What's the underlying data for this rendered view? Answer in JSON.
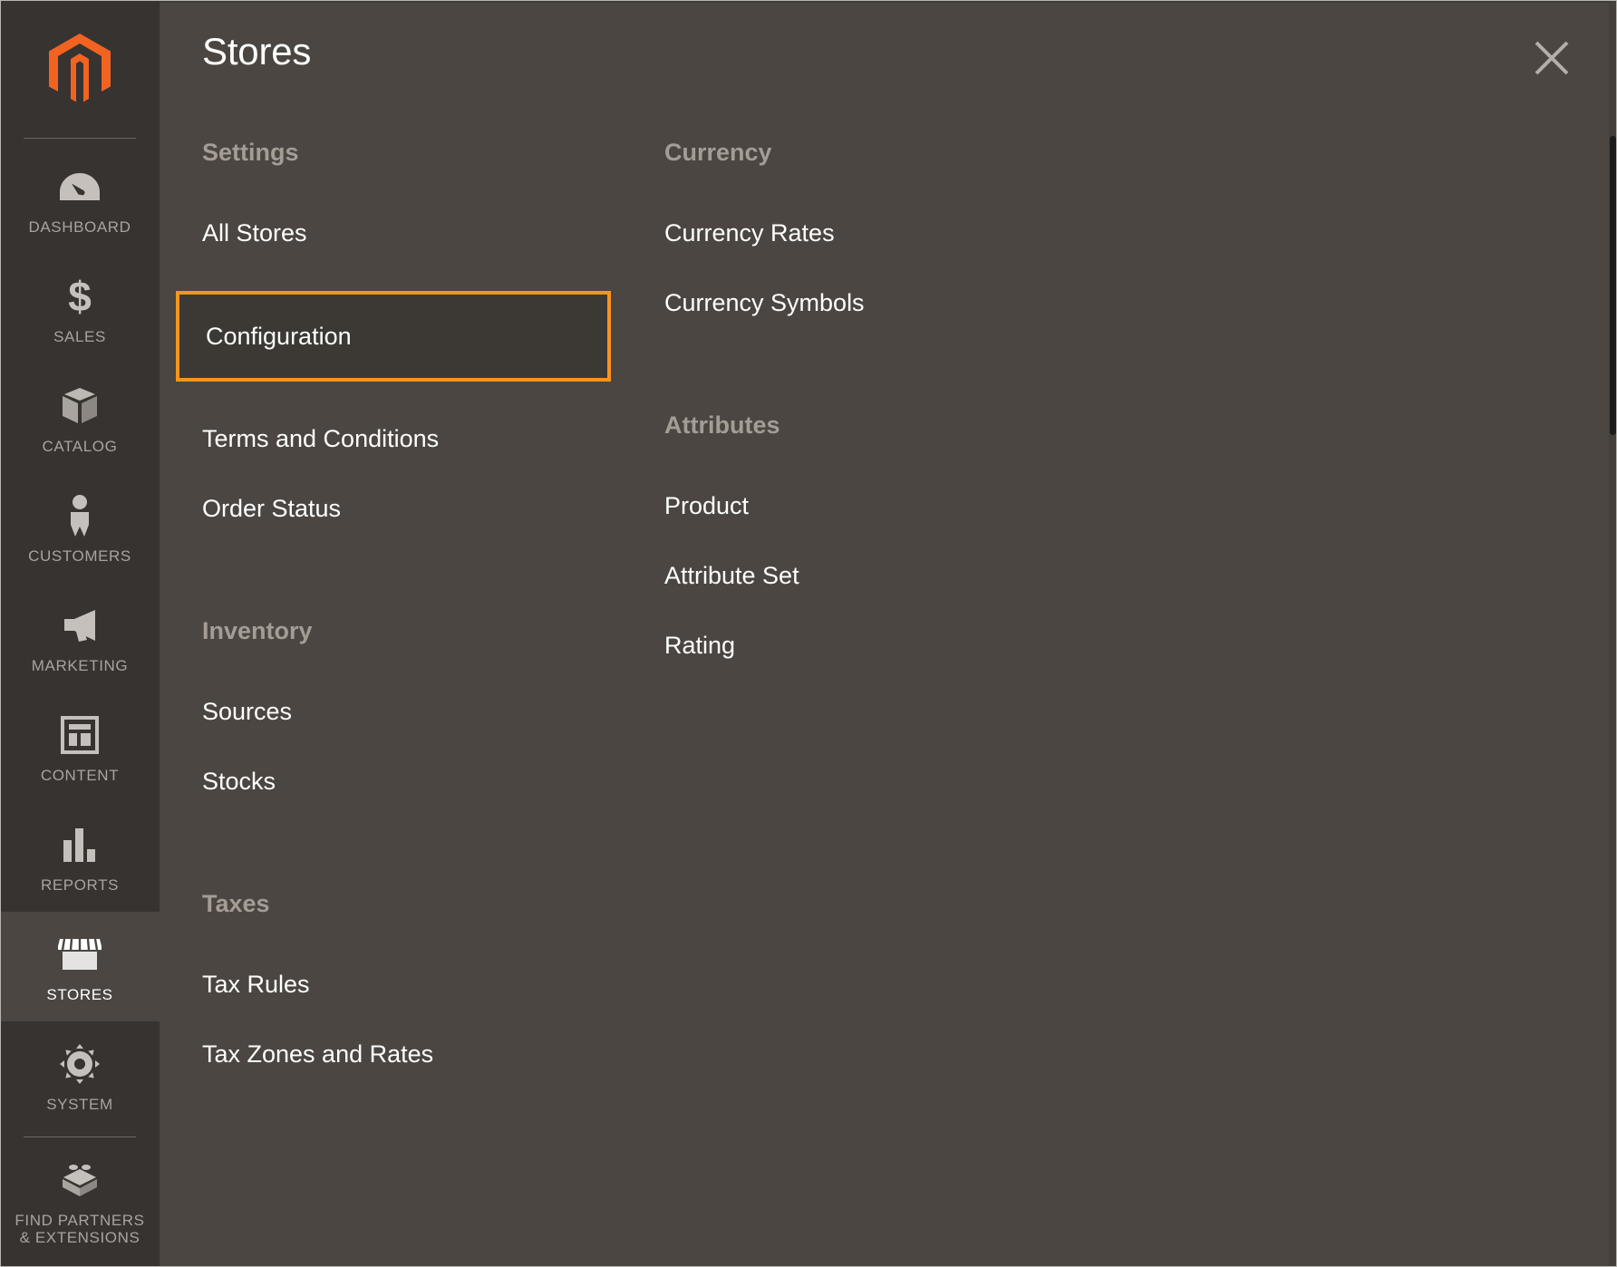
{
  "brand": {
    "accent": "#f79421",
    "logo_icon": "magento-logo-icon"
  },
  "sidebar": {
    "items": [
      {
        "label": "DASHBOARD",
        "icon": "dashboard-gauge-icon",
        "active": false
      },
      {
        "label": "SALES",
        "icon": "dollar-sign-icon",
        "active": false
      },
      {
        "label": "CATALOG",
        "icon": "box-icon",
        "active": false
      },
      {
        "label": "CUSTOMERS",
        "icon": "person-icon",
        "active": false
      },
      {
        "label": "MARKETING",
        "icon": "megaphone-icon",
        "active": false
      },
      {
        "label": "CONTENT",
        "icon": "layout-page-icon",
        "active": false
      },
      {
        "label": "REPORTS",
        "icon": "bar-chart-icon",
        "active": false
      },
      {
        "label": "STORES",
        "icon": "storefront-icon",
        "active": true
      },
      {
        "label": "SYSTEM",
        "icon": "gear-icon",
        "active": false
      },
      {
        "label": "FIND PARTNERS\n& EXTENSIONS",
        "icon": "lego-brick-icon",
        "active": false
      }
    ]
  },
  "panel": {
    "title": "Stores",
    "close_icon": "close-x-icon",
    "columns": [
      {
        "groups": [
          {
            "title": "Settings",
            "items": [
              {
                "label": "All Stores",
                "highlighted": false
              },
              {
                "label": "Configuration",
                "highlighted": true
              },
              {
                "label": "Terms and Conditions",
                "highlighted": false
              },
              {
                "label": "Order Status",
                "highlighted": false
              }
            ]
          },
          {
            "title": "Inventory",
            "items": [
              {
                "label": "Sources",
                "highlighted": false
              },
              {
                "label": "Stocks",
                "highlighted": false
              }
            ]
          },
          {
            "title": "Taxes",
            "items": [
              {
                "label": "Tax Rules",
                "highlighted": false
              },
              {
                "label": "Tax Zones and Rates",
                "highlighted": false
              }
            ]
          }
        ]
      },
      {
        "groups": [
          {
            "title": "Currency",
            "items": [
              {
                "label": "Currency Rates",
                "highlighted": false
              },
              {
                "label": "Currency Symbols",
                "highlighted": false
              }
            ]
          },
          {
            "title": "Attributes",
            "items": [
              {
                "label": "Product",
                "highlighted": false
              },
              {
                "label": "Attribute Set",
                "highlighted": false
              },
              {
                "label": "Rating",
                "highlighted": false
              }
            ]
          }
        ]
      }
    ]
  }
}
